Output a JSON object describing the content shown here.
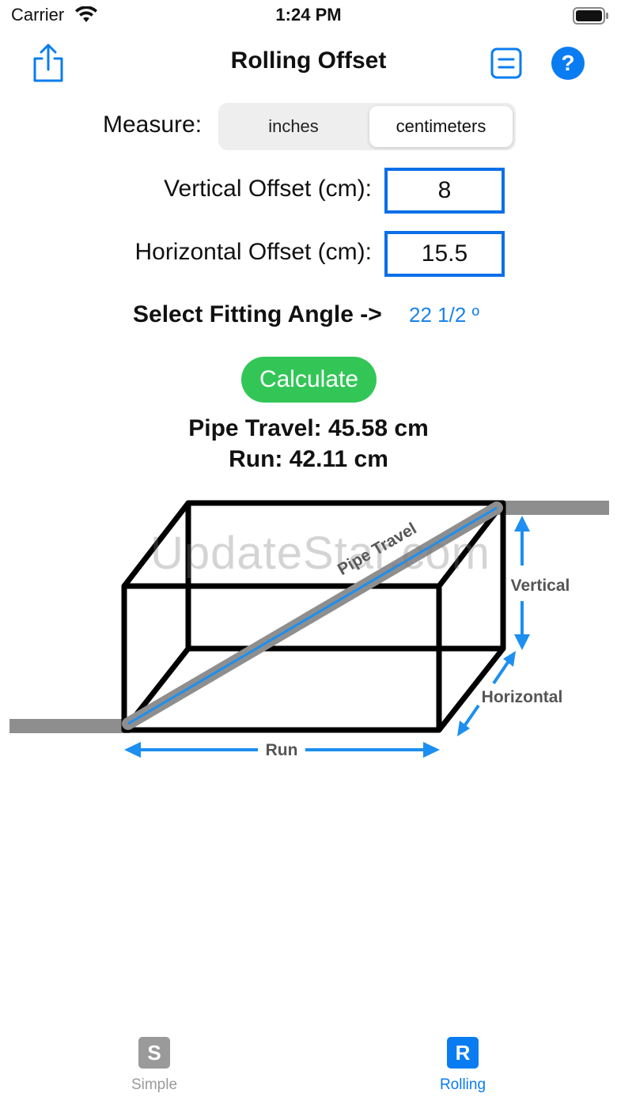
{
  "status": {
    "carrier": "Carrier",
    "time": "1:24 PM"
  },
  "nav": {
    "title": "Rolling Offset",
    "help_label": "?"
  },
  "measure": {
    "label": "Measure:",
    "options": [
      "inches",
      "centimeters"
    ],
    "selected": "centimeters"
  },
  "fields": {
    "vertical": {
      "label": "Vertical Offset (cm):",
      "value": "8"
    },
    "horizontal": {
      "label": "Horizontal Offset (cm):",
      "value": "15.5"
    }
  },
  "angle": {
    "label": "Select Fitting Angle ->",
    "value": "22 1/2 º"
  },
  "calculate_label": "Calculate",
  "results": {
    "pipe_travel": "Pipe Travel: 45.58 cm",
    "run": "Run: 42.11 cm"
  },
  "diagram": {
    "pipe_travel": "Pipe Travel",
    "vertical": "Vertical",
    "horizontal": "Horizontal",
    "run": "Run"
  },
  "watermark": "UpdateStar.com",
  "tabs": [
    {
      "icon": "S",
      "label": "Simple"
    },
    {
      "icon": "R",
      "label": "Rolling"
    }
  ],
  "colors": {
    "accent": "#0a7cf1",
    "calculate": "#33c657",
    "pipe": "#8e8e8e",
    "inactive_tab": "#9a9a9a"
  }
}
